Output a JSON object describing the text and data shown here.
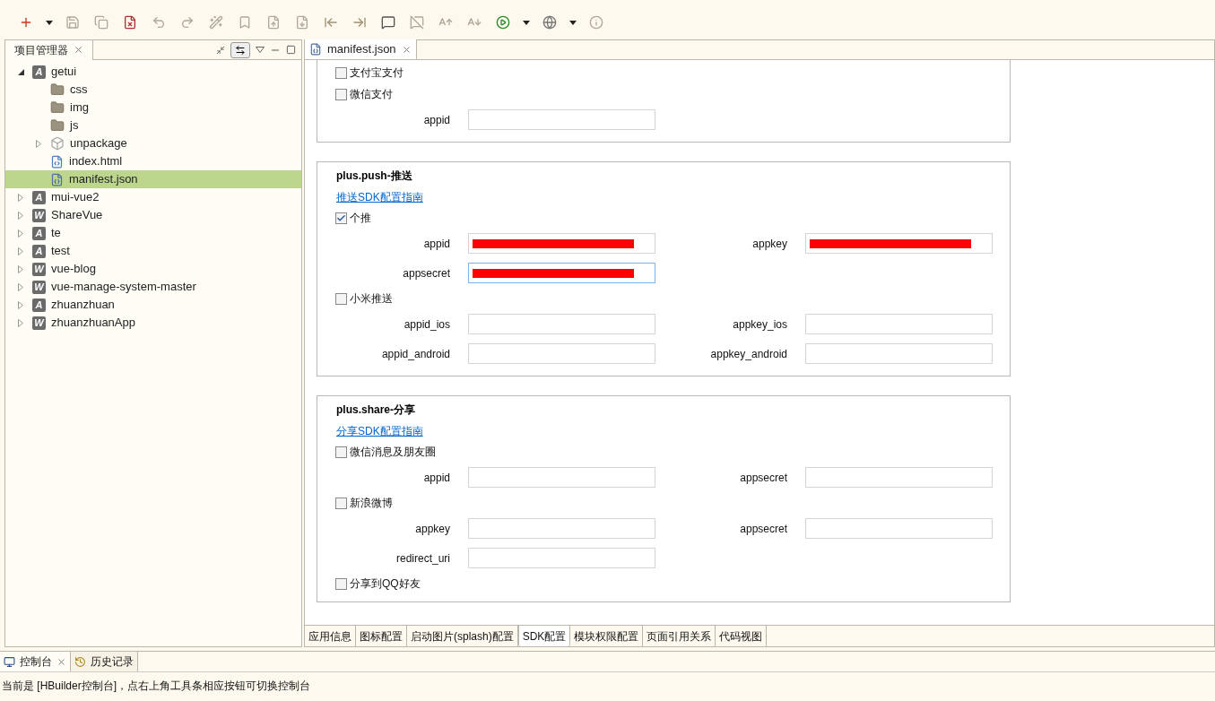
{
  "toolbar": {
    "buttons": [
      {
        "kind": "new"
      },
      {
        "kind": "caret"
      },
      {
        "kind": "save"
      },
      {
        "kind": "save-all"
      },
      {
        "kind": "close-file"
      },
      {
        "kind": "undo"
      },
      {
        "kind": "redo"
      },
      {
        "kind": "format"
      },
      {
        "kind": "bookmark"
      },
      {
        "kind": "import"
      },
      {
        "kind": "export"
      },
      {
        "kind": "indent-left"
      },
      {
        "kind": "indent-right"
      },
      {
        "kind": "comment"
      },
      {
        "kind": "uncomment"
      },
      {
        "kind": "font-up"
      },
      {
        "kind": "font-down"
      },
      {
        "kind": "run"
      },
      {
        "kind": "caret"
      },
      {
        "kind": "browser"
      },
      {
        "kind": "caret"
      },
      {
        "kind": "info"
      }
    ]
  },
  "project_panel": {
    "tab": {
      "label": "项目管理器",
      "selected": true
    },
    "tree": [
      {
        "label": "getui",
        "kind": "project",
        "icon_letter": "A",
        "expanded": true,
        "selected": false,
        "children": [
          {
            "label": "css",
            "kind": "folder",
            "selected": false
          },
          {
            "label": "img",
            "kind": "folder",
            "selected": false
          },
          {
            "label": "js",
            "kind": "folder",
            "selected": false
          },
          {
            "label": "unpackage",
            "kind": "package",
            "expanded": false,
            "selected": false
          },
          {
            "label": "index.html",
            "kind": "html",
            "selected": false
          },
          {
            "label": "manifest.json",
            "kind": "json",
            "selected": true
          }
        ]
      },
      {
        "label": "mui-vue2",
        "kind": "project",
        "icon_letter": "A",
        "expanded": false,
        "selected": false
      },
      {
        "label": "ShareVue",
        "kind": "project",
        "icon_letter": "W",
        "expanded": false,
        "selected": false
      },
      {
        "label": "te",
        "kind": "project",
        "icon_letter": "A",
        "expanded": false,
        "selected": false
      },
      {
        "label": "test",
        "kind": "project",
        "icon_letter": "A",
        "expanded": false,
        "selected": false
      },
      {
        "label": "vue-blog",
        "kind": "project",
        "icon_letter": "W",
        "expanded": false,
        "selected": false
      },
      {
        "label": "vue-manage-system-master",
        "kind": "project",
        "icon_letter": "W",
        "expanded": false,
        "selected": false
      },
      {
        "label": "zhuanzhuan",
        "kind": "project",
        "icon_letter": "A",
        "expanded": false,
        "selected": false
      },
      {
        "label": "zhuanzhuanApp",
        "kind": "project",
        "icon_letter": "W",
        "expanded": false,
        "selected": false
      }
    ]
  },
  "editor": {
    "tabs": [
      {
        "label": "manifest.json",
        "selected": true
      }
    ],
    "sections": [
      {
        "items": [
          {
            "kind": "checkbox",
            "label": "支付宝支付",
            "checked": false
          },
          {
            "kind": "checkbox",
            "label": "微信支付",
            "checked": false
          },
          {
            "kind": "fields",
            "fields": [
              {
                "label": "appid",
                "redacted": false,
                "focused": false
              }
            ]
          }
        ]
      },
      {
        "title": "plus.push-推送",
        "items": [
          {
            "kind": "link",
            "label": "推送SDK配置指南"
          },
          {
            "kind": "checkbox",
            "label": "个推",
            "checked": true
          },
          {
            "kind": "fields",
            "fields": [
              {
                "label": "appid",
                "redacted": true,
                "focused": false
              },
              {
                "label": "appkey",
                "redacted": true,
                "focused": false
              }
            ]
          },
          {
            "kind": "fields",
            "fields": [
              {
                "label": "appsecret",
                "redacted": true,
                "focused": true
              }
            ]
          },
          {
            "kind": "checkbox",
            "label": "小米推送",
            "checked": false
          },
          {
            "kind": "fields",
            "fields": [
              {
                "label": "appid_ios",
                "redacted": false,
                "focused": false
              },
              {
                "label": "appkey_ios",
                "redacted": false,
                "focused": false
              }
            ]
          },
          {
            "kind": "fields",
            "fields": [
              {
                "label": "appid_android",
                "redacted": false,
                "focused": false
              },
              {
                "label": "appkey_android",
                "redacted": false,
                "focused": false
              }
            ]
          }
        ]
      },
      {
        "title": "plus.share-分享",
        "items": [
          {
            "kind": "link",
            "label": "分享SDK配置指南"
          },
          {
            "kind": "checkbox",
            "label": "微信消息及朋友圈",
            "checked": false
          },
          {
            "kind": "fields",
            "fields": [
              {
                "label": "appid",
                "redacted": false,
                "focused": false
              },
              {
                "label": "appsecret",
                "redacted": false,
                "focused": false
              }
            ]
          },
          {
            "kind": "checkbox",
            "label": "新浪微博",
            "checked": false
          },
          {
            "kind": "fields",
            "fields": [
              {
                "label": "appkey",
                "redacted": false,
                "focused": false
              },
              {
                "label": "appsecret",
                "redacted": false,
                "focused": false
              }
            ]
          },
          {
            "kind": "fields",
            "fields": [
              {
                "label": "redirect_uri",
                "redacted": false,
                "focused": false
              }
            ]
          },
          {
            "kind": "checkbox",
            "label": "分享到QQ好友",
            "checked": false
          }
        ]
      }
    ],
    "bottom_tabs": [
      {
        "label": "应用信息",
        "selected": false
      },
      {
        "label": "图标配置",
        "selected": false
      },
      {
        "label": "启动图片(splash)配置",
        "selected": false
      },
      {
        "label": "SDK配置",
        "selected": true
      },
      {
        "label": "模块权限配置",
        "selected": false
      },
      {
        "label": "页面引用关系",
        "selected": false
      },
      {
        "label": "代码视图",
        "selected": false
      }
    ]
  },
  "console": {
    "tabs": [
      {
        "label": "控制台",
        "kind": "console",
        "selected": true
      },
      {
        "label": "历史记录",
        "kind": "history",
        "selected": false
      }
    ],
    "message": "当前是 [HBuilder控制台]，点右上角工具条相应按钮可切换控制台"
  }
}
